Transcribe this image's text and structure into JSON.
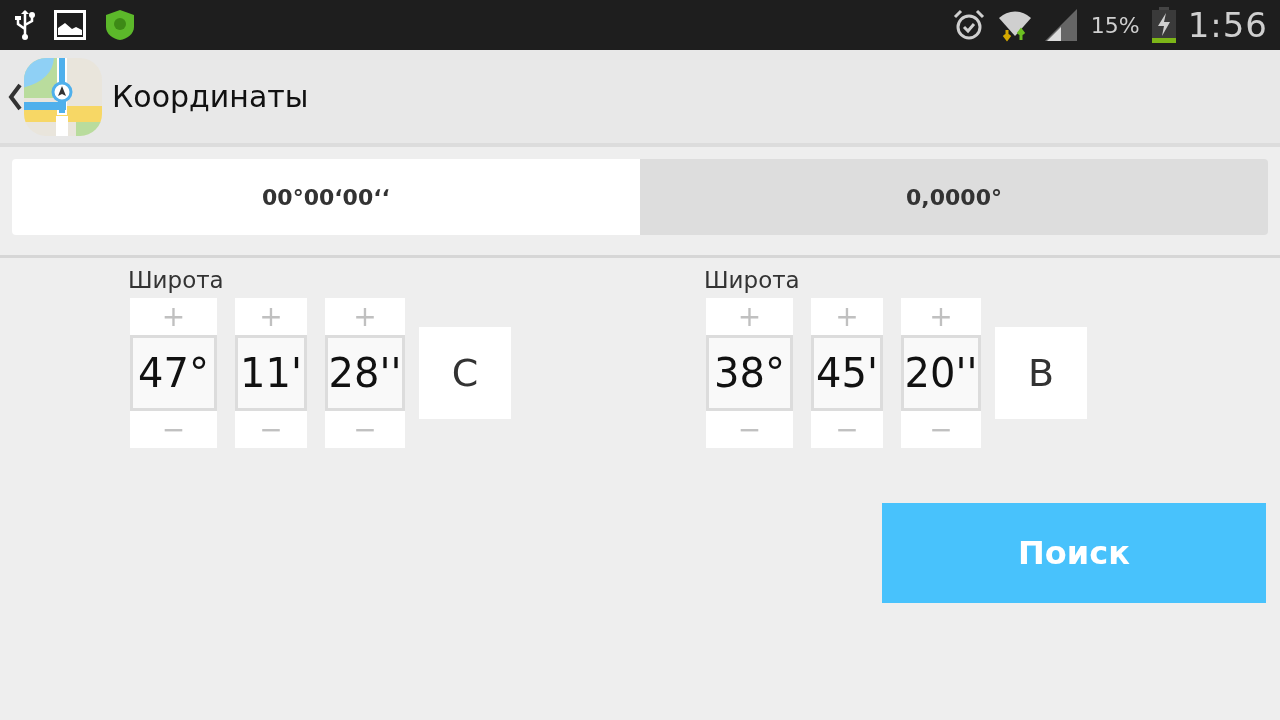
{
  "status_bar": {
    "battery": "15%",
    "time": "1:56"
  },
  "action_bar": {
    "title": "Координаты"
  },
  "tabs": [
    {
      "label": "00°00ʻ00ʻʻ",
      "selected": true
    },
    {
      "label": "0,0000°",
      "selected": false
    }
  ],
  "coordinates": [
    {
      "label": "Широта",
      "hemisphere": "С",
      "fields": [
        {
          "plus": "+",
          "value": "47°",
          "minus": "−"
        },
        {
          "plus": "+",
          "value": "11'",
          "minus": "−"
        },
        {
          "plus": "+",
          "value": "28''",
          "minus": "−"
        }
      ]
    },
    {
      "label": "Широта",
      "hemisphere": "В",
      "fields": [
        {
          "plus": "+",
          "value": "38°",
          "minus": "−"
        },
        {
          "plus": "+",
          "value": "45'",
          "minus": "−"
        },
        {
          "plus": "+",
          "value": "20''",
          "minus": "−"
        }
      ]
    }
  ],
  "search_button": "Поиск"
}
